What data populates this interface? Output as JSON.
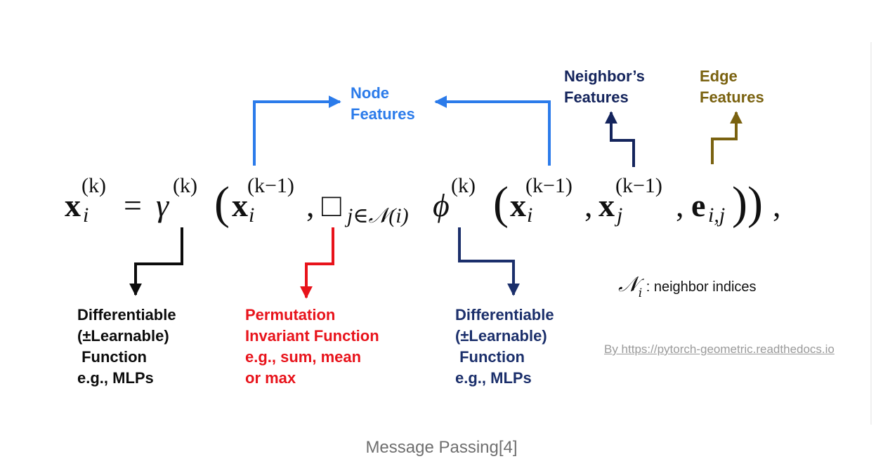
{
  "figure": {
    "labels": {
      "node_features": "Node\nFeatures",
      "neighbor_features": "Neighbor’s\nFeatures",
      "edge_features": "Edge\nFeatures",
      "gamma_desc": "Differentiable\n(±Learnable)\n Function\ne.g., MLPs",
      "aggregate_desc": "Permutation\nInvariant Function\ne.g., sum, mean\nor max",
      "phi_desc": "Differentiable\n(±Learnable)\n Function\ne.g., MLPs"
    },
    "legend": {
      "symbol": "𝒩",
      "symbol_sub": "i",
      "text": " : neighbor indices"
    },
    "credit": "By https://pytorch-geometric.readthedocs.io",
    "colors": {
      "node_features": "#2b7bea",
      "neighbor_features": "#14245c",
      "edge_features": "#7a6210",
      "gamma": "#0c0c0c",
      "aggregate": "#e8131b",
      "phi": "#1b2f6b"
    }
  },
  "equation": {
    "x": "x",
    "sub_i": "i",
    "sub_j": "j",
    "sup_k": "(k)",
    "sup_k1": "(k−1)",
    "equals": "=",
    "gamma": "γ",
    "phi": "ϕ",
    "comma": ",",
    "box": "□",
    "agg_sub": "j∈𝒩(i)",
    "e": "e",
    "sub_ij": "i,j",
    "open_paren": "(",
    "close_paren": ")"
  },
  "caption": "Message Passing[4]"
}
